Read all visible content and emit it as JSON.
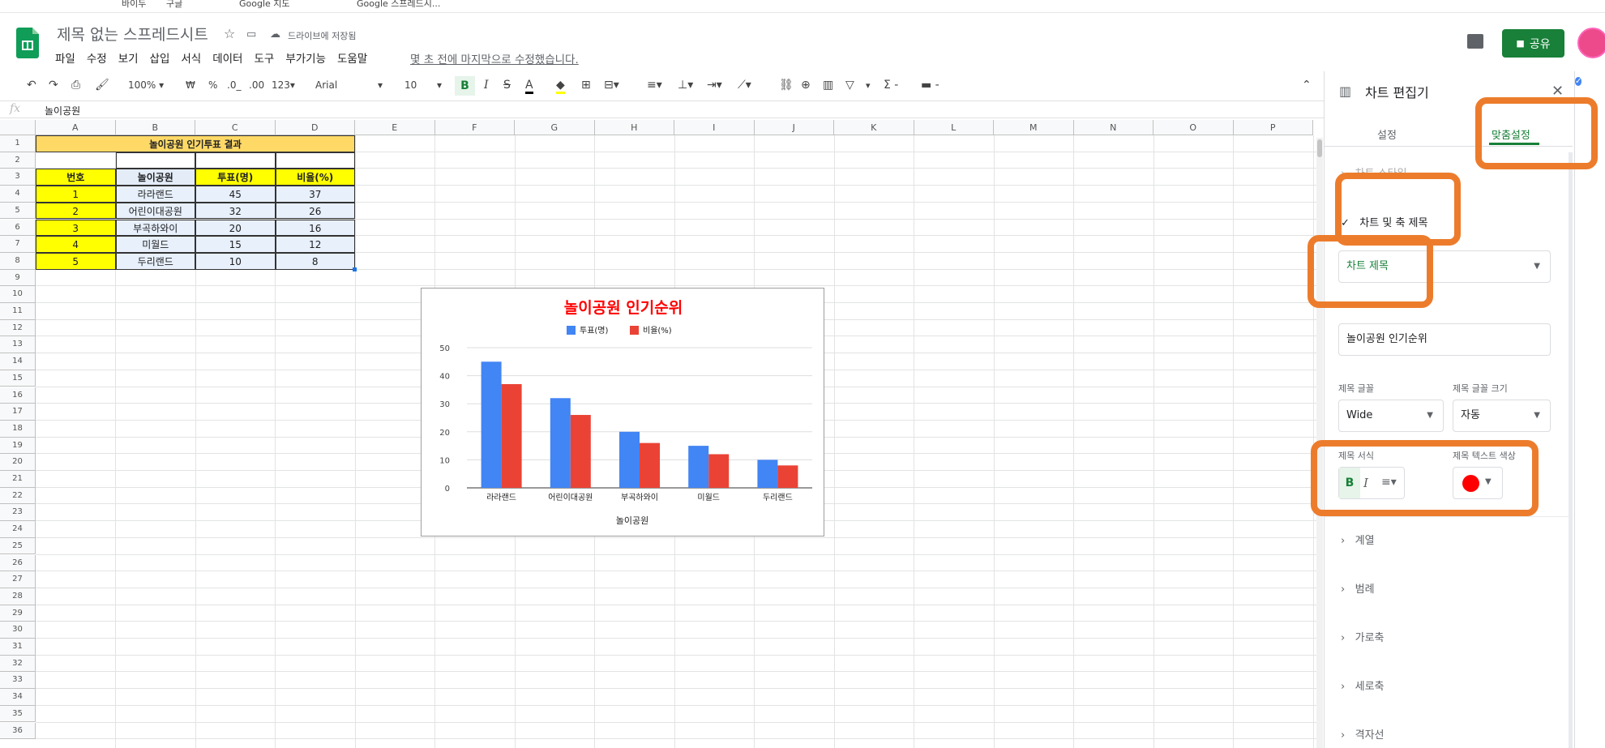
{
  "browser_bar": [
    "바이두",
    "구글",
    "Google 지도",
    "Google 스프레드시..."
  ],
  "header": {
    "doc_title": "제목 없는 스프레드시트",
    "saved_status": "드라이브에 저장됨",
    "menus": [
      "파일",
      "수정",
      "보기",
      "삽입",
      "서식",
      "데이터",
      "도구",
      "부가기능",
      "도움말"
    ],
    "last_edit": "몇 초 전에 마지막으로 수정했습니다.",
    "share_label": "공유"
  },
  "toolbar": {
    "zoom": "100%",
    "currency": "₩",
    "percent": "%",
    "dec_decrease": ".0_",
    "dec_increase": ".00",
    "format_more": "123",
    "font": "Arial",
    "font_size": "10",
    "bold": "B",
    "italic": "I",
    "strike": "S",
    "text_color": "A",
    "sigma": "Σ"
  },
  "formula_bar": {
    "fx": "fx",
    "value": "놀이공원"
  },
  "columns": [
    "A",
    "B",
    "C",
    "D",
    "E",
    "F",
    "G",
    "H",
    "I",
    "J",
    "K",
    "L",
    "M",
    "N",
    "O",
    "P"
  ],
  "row_count": 36,
  "sheet": {
    "title": "놀이공원 인기투표 결과",
    "headers": [
      "번호",
      "놀이공원",
      "투표(명)",
      "비율(%)"
    ],
    "rows": [
      [
        "1",
        "라라랜드",
        "45",
        "37"
      ],
      [
        "2",
        "어린이대공원",
        "32",
        "26"
      ],
      [
        "3",
        "부곡하와이",
        "20",
        "16"
      ],
      [
        "4",
        "미월드",
        "15",
        "12"
      ],
      [
        "5",
        "두리랜드",
        "10",
        "8"
      ]
    ]
  },
  "chart_data": {
    "type": "bar",
    "title": "놀이공원 인기순위",
    "xlabel": "놀이공원",
    "ylabel": "",
    "categories": [
      "라라랜드",
      "어린이대공원",
      "부곡하와이",
      "미월드",
      "두리랜드"
    ],
    "series": [
      {
        "name": "투표(명)",
        "values": [
          45,
          32,
          20,
          15,
          10
        ],
        "color": "#4285f4"
      },
      {
        "name": "비율(%)",
        "values": [
          37,
          26,
          16,
          12,
          8
        ],
        "color": "#ea4335"
      }
    ],
    "ylim": [
      0,
      50
    ],
    "yticks": [
      "0",
      "10",
      "20",
      "30",
      "40",
      "50"
    ],
    "grid": true,
    "legend": "top",
    "title_color": "#ff0000"
  },
  "panel": {
    "title": "차트 편집기",
    "tabs": [
      "설정",
      "맞춤설정"
    ],
    "section_chart_style": "차트 스타일",
    "section_titles": "차트 및 축 제목",
    "title_type_selected": "차트 제목",
    "title_text_value": "놀이공원 인기순위",
    "title_font_label": "제목 글꼴",
    "title_font_value": "Wide",
    "title_size_label": "제목 글꼴 크기",
    "title_size_value": "자동",
    "title_format_label": "제목 서식",
    "title_color_label": "제목 텍스트 색상",
    "title_color": "#ff0000",
    "collapsed_sections": [
      "계열",
      "범례",
      "가로축",
      "세로축",
      "격자선"
    ]
  }
}
